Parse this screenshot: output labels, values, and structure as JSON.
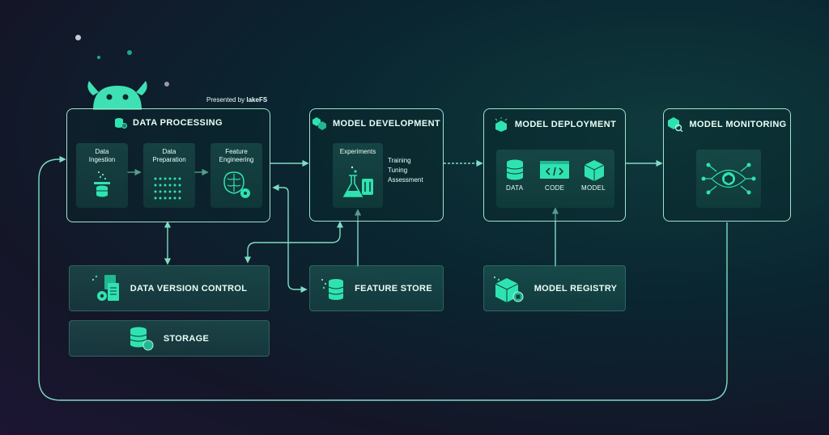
{
  "presented_by": "Presented by",
  "brand": "lakeFS",
  "stages": {
    "data_processing": {
      "title": "DATA PROCESSING",
      "panels": [
        "Data\nIngestion",
        "Data\nPreparation",
        "Feature\nEngineering"
      ]
    },
    "model_development": {
      "title": "MODEL DEVELOPMENT",
      "panel": "Experiments",
      "activities": [
        "Training",
        "Tuning",
        "Assessment"
      ]
    },
    "model_deployment": {
      "title": "MODEL DEPLOYMENT",
      "items": [
        "DATA",
        "CODE",
        "MODEL"
      ]
    },
    "model_monitoring": {
      "title": "MODEL MONITORING"
    }
  },
  "components": {
    "data_version_control": "DATA VERSION CONTROL",
    "storage": "STORAGE",
    "feature_store": "FEATURE STORE",
    "model_registry": "MODEL REGISTRY"
  },
  "colors": {
    "accent": "#2fe3b0",
    "line": "#7fdcc4",
    "border": "#9fe3cf"
  }
}
